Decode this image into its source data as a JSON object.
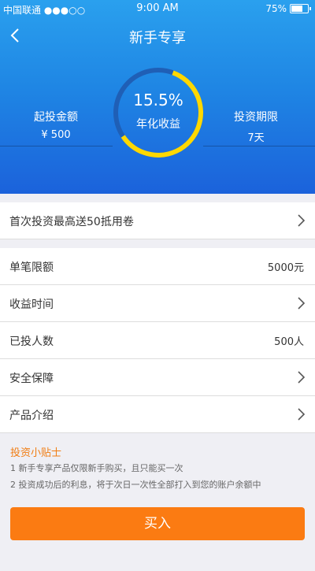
{
  "status_bar": {
    "carrier": "中国联通 ●●●○○",
    "time": "9:00 AM",
    "battery": "75%"
  },
  "nav": {
    "title": "新手专享",
    "back_icon": "chevron-left-icon"
  },
  "hero": {
    "rate": "15.5%",
    "rate_label": "年化收益",
    "min_amount_label": "起投金额",
    "min_amount_value": "¥ 500",
    "term_label": "投资期限",
    "term_value": "7天",
    "ring_progress": 0.6,
    "colors": {
      "ring_track": "#1f5fb6",
      "ring_fill": "#ffd800"
    }
  },
  "coupon": {
    "label": "首次投资最高送50抵用卷"
  },
  "list": {
    "single_limit_label": "单笔限额",
    "single_limit_value": "5000元",
    "earning_time_label": "收益时间",
    "investors_label": "已投人数",
    "investors_value": "500人",
    "security_label": "安全保障",
    "product_intro_label": "产品介绍"
  },
  "tips": {
    "title": "投资小贴士",
    "line1": "1  新手专享产品仅限新手购买，且只能买一次",
    "line2": "2  投资成功后的利息，将于次日一次性全部打入到您的账户余额中"
  },
  "buy_button": {
    "label": "买入",
    "color": "#fb7b12"
  }
}
